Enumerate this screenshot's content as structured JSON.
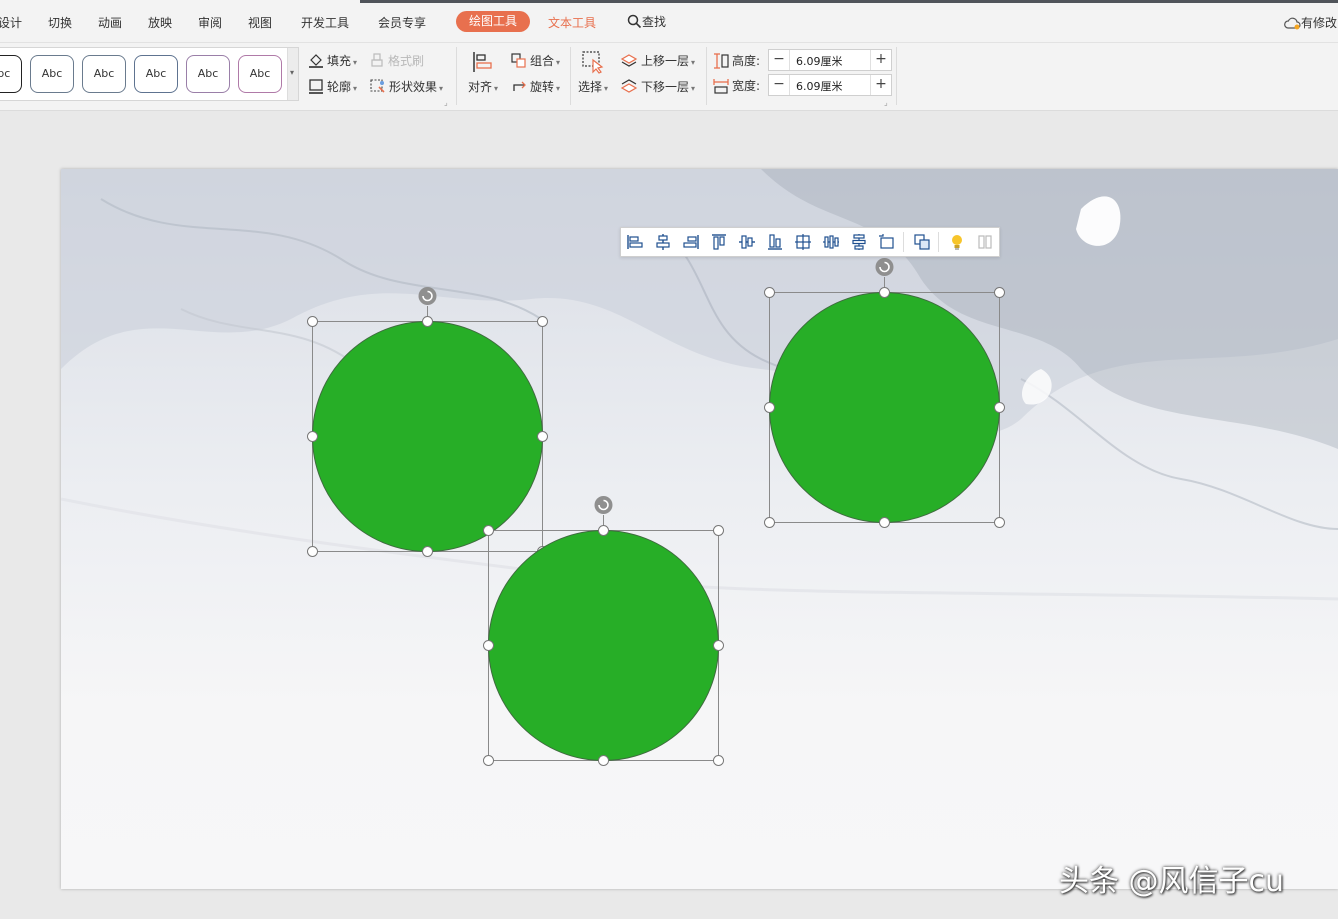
{
  "menubar": {
    "items": [
      "设计",
      "切换",
      "动画",
      "放映",
      "审阅",
      "视图",
      "开发工具",
      "会员专享"
    ],
    "active_tab": "绘图工具",
    "text_tool_tab": "文本工具",
    "search": "查找",
    "cloud_status": "有修改"
  },
  "ribbon": {
    "style_gallery": [
      "Abc",
      "Abc",
      "Abc",
      "Abc",
      "Abc",
      "Abc"
    ],
    "fill": "填充",
    "format_painter": "格式刷",
    "outline": "轮廓",
    "shape_effects": "形状效果",
    "align": "对齐",
    "group": "组合",
    "rotate": "旋转",
    "select": "选择",
    "bring_forward": "上移一层",
    "send_backward": "下移一层",
    "height_label": "高度:",
    "height_value": "6.09厘米",
    "width_label": "宽度:",
    "width_value": "6.09厘米",
    "minus": "−",
    "plus": "+"
  },
  "canvas": {
    "shape_color": "#27ae27",
    "shape_count": 3,
    "float_toolbar_icons": [
      "align-left-icon",
      "align-center-icon",
      "align-right-icon",
      "align-top-icon",
      "align-middle-icon",
      "align-bottom-icon",
      "distribute-horizontal-icon",
      "distribute-horizontal-alt-icon",
      "distribute-vertical-icon",
      "canvas-align-icon",
      "group-icon",
      "lightbulb-icon",
      "more-icon"
    ]
  },
  "watermark": "头条 @风信子cu"
}
